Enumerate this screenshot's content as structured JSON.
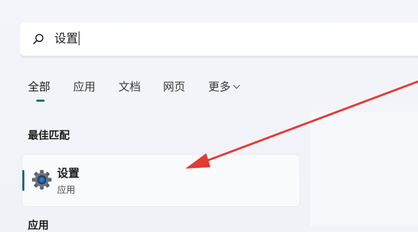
{
  "search": {
    "query": "设置"
  },
  "tabs": [
    {
      "label": "全部",
      "active": true
    },
    {
      "label": "应用",
      "active": false
    },
    {
      "label": "文档",
      "active": false
    },
    {
      "label": "网页",
      "active": false
    },
    {
      "label": "更多",
      "active": false
    }
  ],
  "best_match": {
    "title": "最佳匹配",
    "item": {
      "name": "设置",
      "type": "应用",
      "icon": "settings-gear-icon"
    }
  },
  "apps_section": {
    "title": "应用"
  },
  "colors": {
    "accent": "#1f6b73",
    "annotation_arrow": "#e53935",
    "background": "#f1f3f8"
  }
}
